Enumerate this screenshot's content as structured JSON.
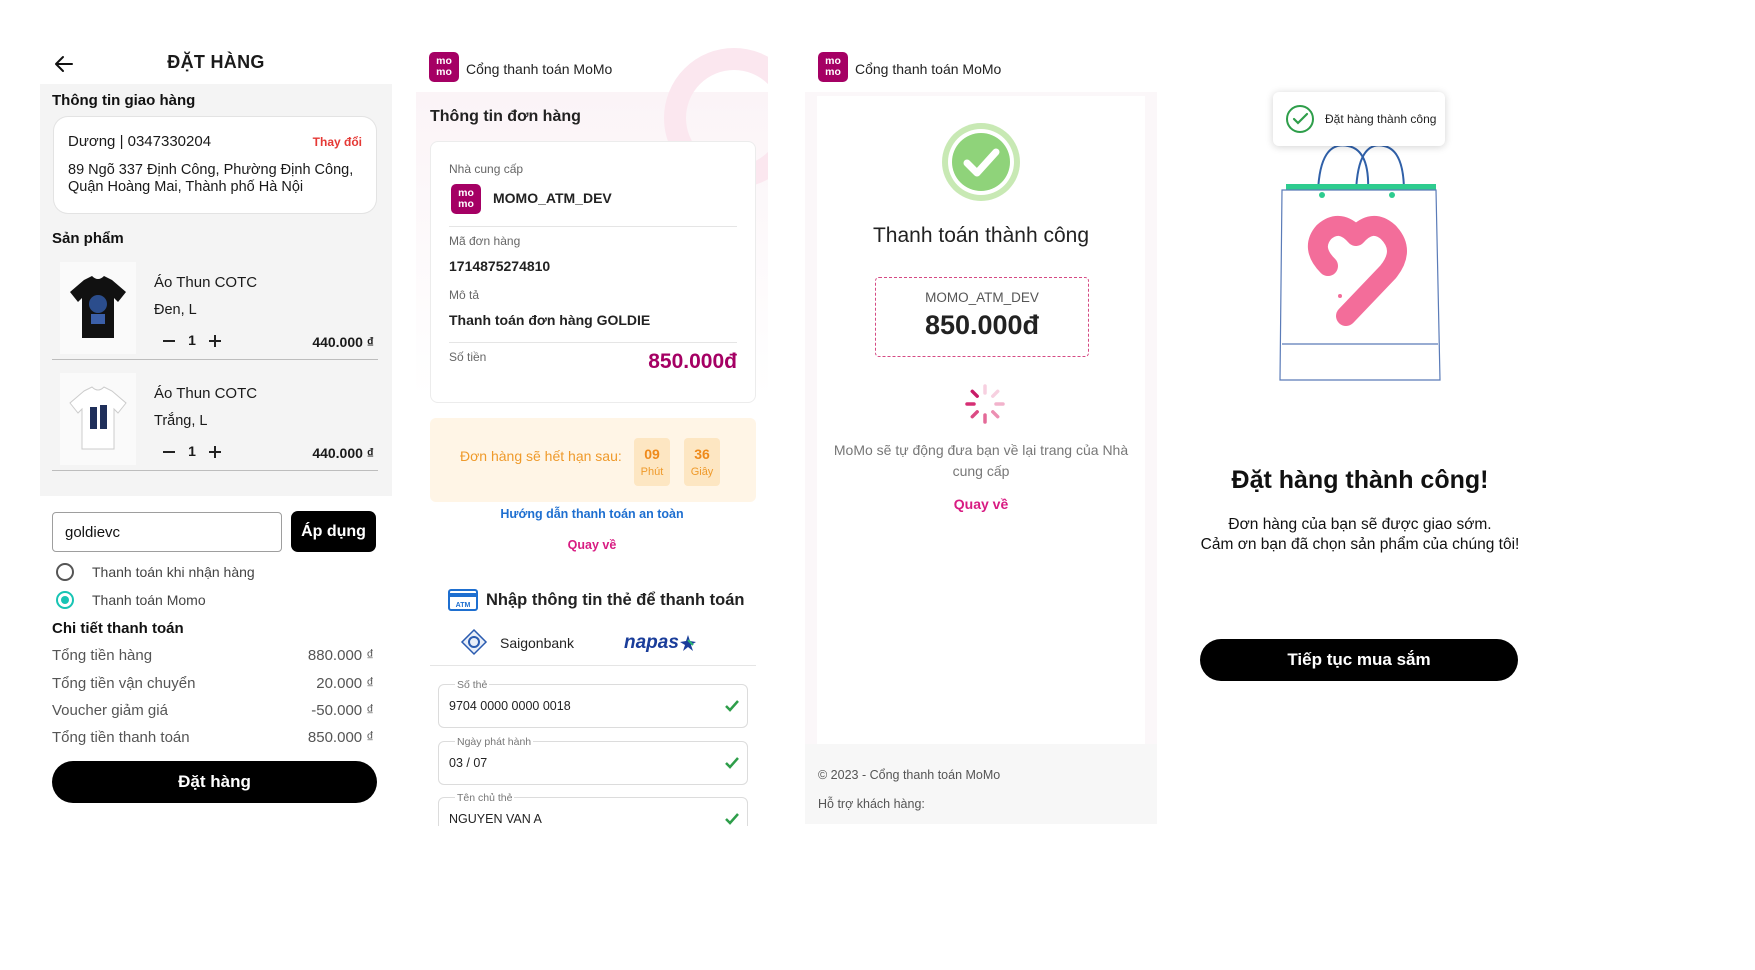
{
  "order": {
    "title": "ĐẶT HÀNG",
    "shipping_label": "Thông tin giao hàng",
    "address": {
      "name_phone": "Dương  | 0347330204",
      "change": "Thay đổi",
      "line1": "89 Ngõ 337 Định Công, Phường Định Công,",
      "line2": "Quận Hoàng Mai, Thành phố Hà Nội"
    },
    "products_label": "Sản phẩm",
    "products": [
      {
        "name": "Áo Thun COTC",
        "variant": "Đen, L",
        "qty": "1",
        "price": "440.000 ₫",
        "shirt_color": "#111111"
      },
      {
        "name": "Áo Thun COTC",
        "variant": "Trắng, L",
        "qty": "1",
        "price": "440.000 ₫",
        "shirt_color": "#ffffff"
      }
    ],
    "voucher_value": "goldievc",
    "apply_label": "Áp dụng",
    "payment_methods": [
      {
        "label": "Thanh toán khi nhận hàng",
        "selected": false
      },
      {
        "label": "Thanh toán Momo",
        "selected": true
      }
    ],
    "summary_label": "Chi tiết thanh toán",
    "summary": [
      {
        "label": "Tổng tiền hàng",
        "value": "880.000 ₫"
      },
      {
        "label": "Tổng tiền vận chuyển",
        "value": "20.000 ₫"
      },
      {
        "label": "Voucher giảm giá",
        "value": "-50.000 ₫"
      },
      {
        "label": "Tổng tiền thanh toán",
        "value": "850.000 ₫"
      }
    ],
    "submit_label": "Đặt hàng"
  },
  "momo_header": {
    "logo_top": "mo",
    "logo_bottom": "mo",
    "title": "Cổng thanh toán MoMo",
    "brand_color": "#a50064"
  },
  "payment": {
    "heading": "Thông tin đơn hàng",
    "provider_label": "Nhà cung cấp",
    "provider": "MOMO_ATM_DEV",
    "order_id_label": "Mã đơn hàng",
    "order_id": "1714875274810",
    "desc_label": "Mô tả",
    "desc": "Thanh toán đơn hàng GOLDIE",
    "amount_label": "Số tiền",
    "amount": "850.000đ",
    "expire_text": "Đơn hàng sẽ hết hạn sau:",
    "minutes": "09",
    "minutes_unit": "Phút",
    "seconds": "36",
    "seconds_unit": "Giây",
    "guide_link": "Hướng dẫn thanh toán an toàn",
    "back_link": "Quay về",
    "card_heading": "Nhập thông tin thẻ để thanh toán",
    "bank": "Saigonbank",
    "network": "napas",
    "fields": [
      {
        "label": "Số thẻ",
        "value": "9704 0000 0000 0018"
      },
      {
        "label": "Ngày phát hành",
        "value": "03 / 07"
      },
      {
        "label": "Tên chủ thẻ",
        "value": "NGUYEN VAN A"
      }
    ]
  },
  "result": {
    "title": "Thanh toán thành công",
    "merchant": "MOMO_ATM_DEV",
    "amount": "850.000đ",
    "message": "MoMo sẽ tự động đưa bạn về lại trang của Nhà cung cấp",
    "back_link": "Quay về",
    "footer_copyright": "© 2023 - Cổng thanh toán MoMo",
    "footer_support": "Hỗ trợ khách hàng:"
  },
  "done": {
    "toast": "Đặt hàng thành công",
    "title": "Đặt hàng thành công!",
    "line1": "Đơn hàng của bạn sẽ được giao sớm.",
    "line2": "Cảm ơn bạn đã chọn sản phẩm của chúng tôi!",
    "button": "Tiếp tục mua sắm"
  }
}
